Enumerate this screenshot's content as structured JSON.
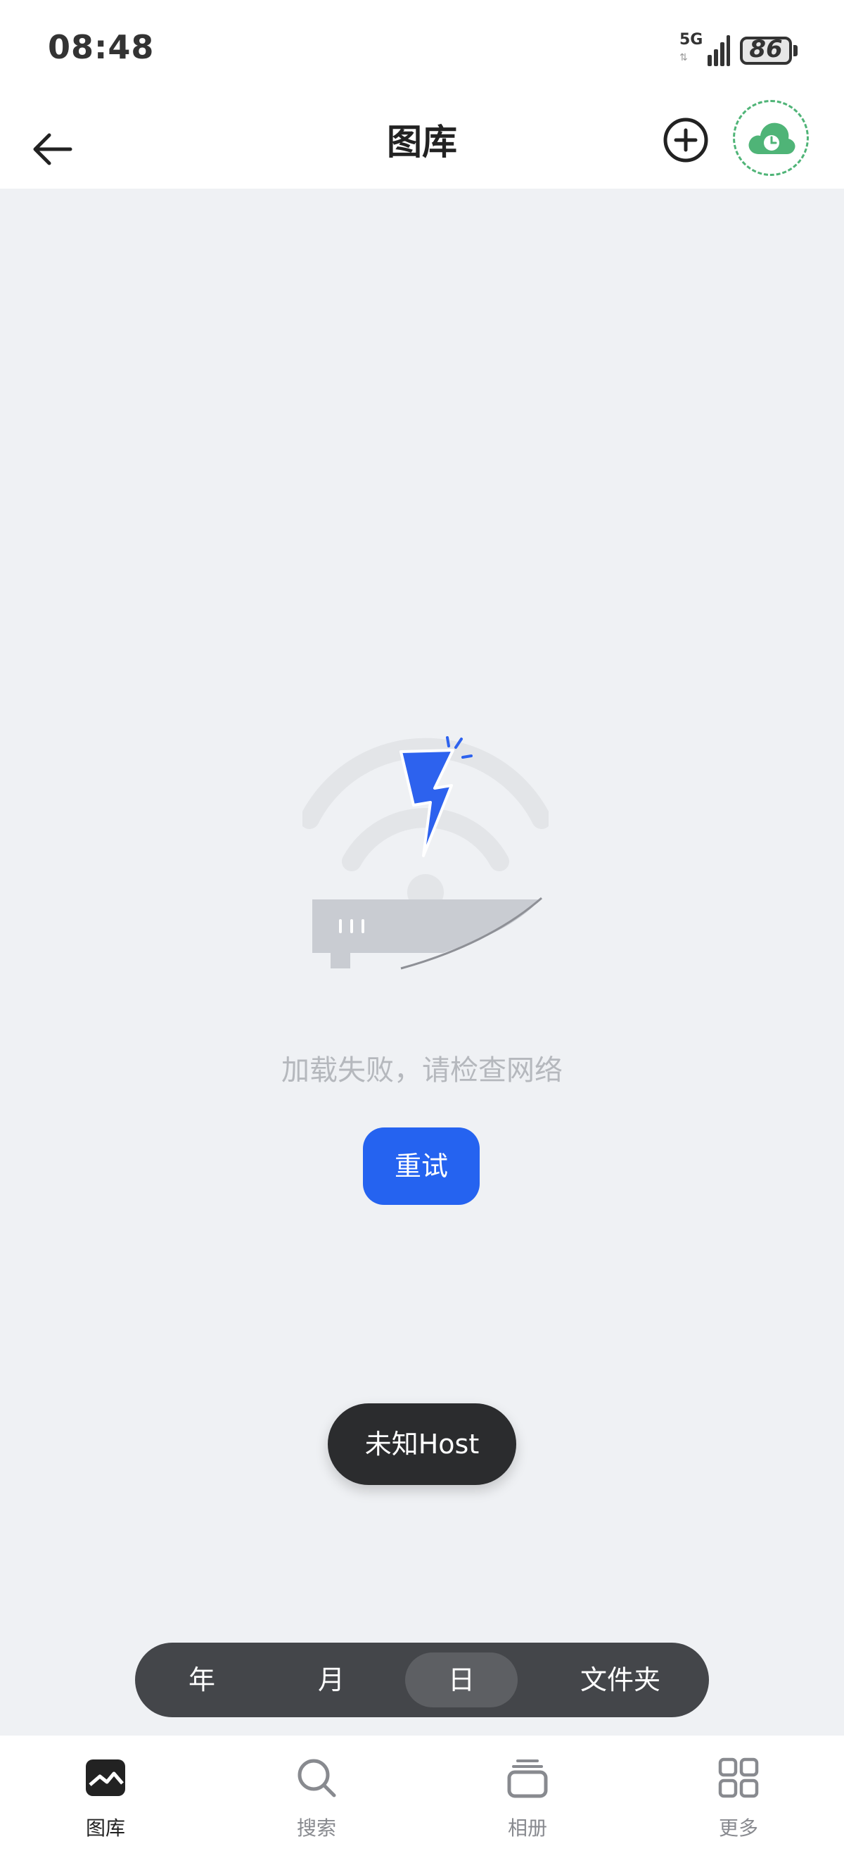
{
  "status_bar": {
    "time": "08:48",
    "network": "5G",
    "battery": "86"
  },
  "header": {
    "title": "图库"
  },
  "main": {
    "error_message": "加载失败，请检查网络",
    "retry_label": "重试",
    "toast": "未知Host"
  },
  "view_switch": {
    "items": [
      {
        "label": "年",
        "active": false
      },
      {
        "label": "月",
        "active": false
      },
      {
        "label": "日",
        "active": true
      },
      {
        "label": "文件夹",
        "active": false
      }
    ]
  },
  "bottom_nav": {
    "items": [
      {
        "label": "图库",
        "icon": "gallery-icon",
        "active": true
      },
      {
        "label": "搜索",
        "icon": "search-icon",
        "active": false
      },
      {
        "label": "相册",
        "icon": "album-icon",
        "active": false
      },
      {
        "label": "更多",
        "icon": "grid-icon",
        "active": false
      }
    ]
  },
  "colors": {
    "accent": "#2563f0",
    "cloud": "#4fb477",
    "background": "#eff1f4",
    "toast": "#2b2c2e"
  }
}
